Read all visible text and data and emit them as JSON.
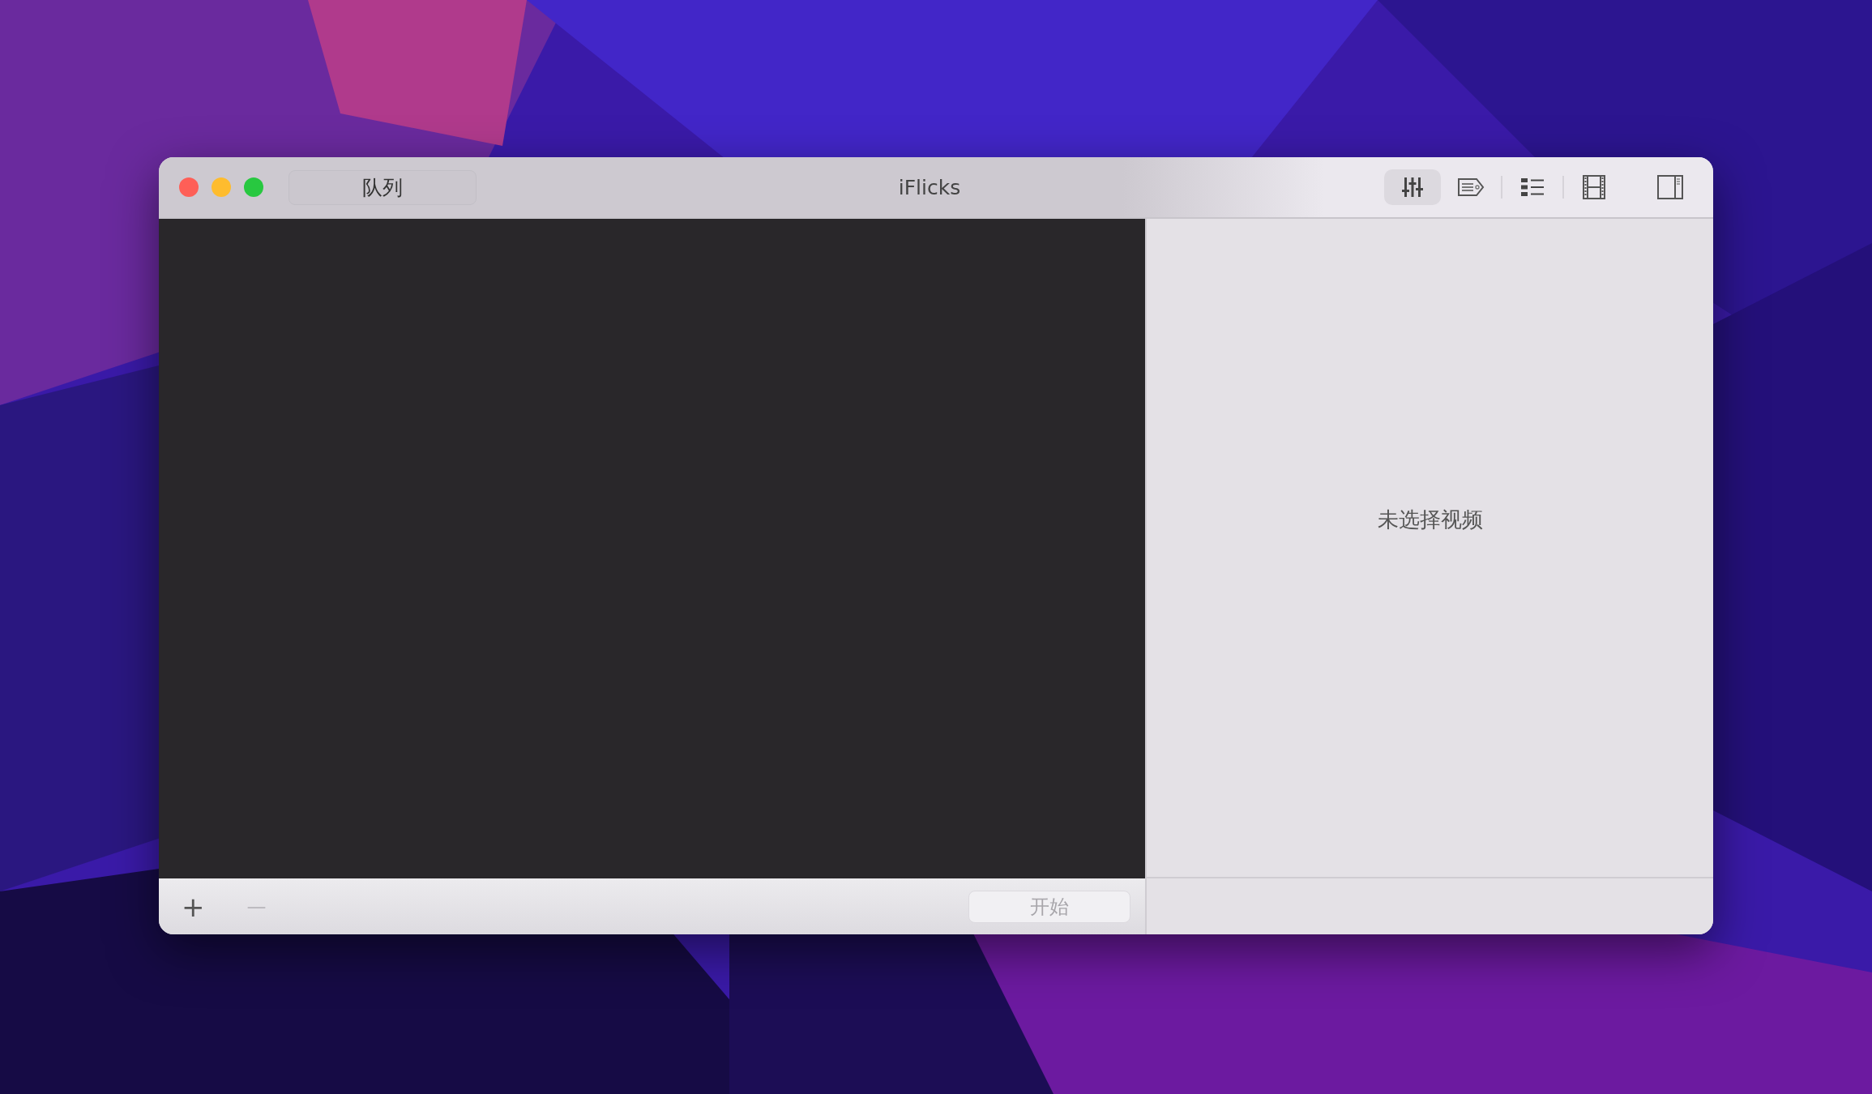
{
  "window": {
    "title": "iFlicks"
  },
  "queue_button": {
    "label": "队列"
  },
  "toolbar": [
    {
      "kind": "sliders",
      "selected": true
    },
    {
      "kind": "tag",
      "selected": false
    },
    {
      "kind": "separator"
    },
    {
      "kind": "list",
      "selected": false
    },
    {
      "kind": "separator"
    },
    {
      "kind": "film",
      "selected": false
    },
    {
      "kind": "sidebar",
      "selected": false
    }
  ],
  "detail_pane": {
    "empty_message": "未选择视频"
  },
  "bottom_bar": {
    "add_button": {
      "label": "+",
      "disabled": false
    },
    "remove_button": {
      "label": "—",
      "disabled": true
    },
    "start_button": {
      "label": "开始",
      "disabled": true
    }
  }
}
